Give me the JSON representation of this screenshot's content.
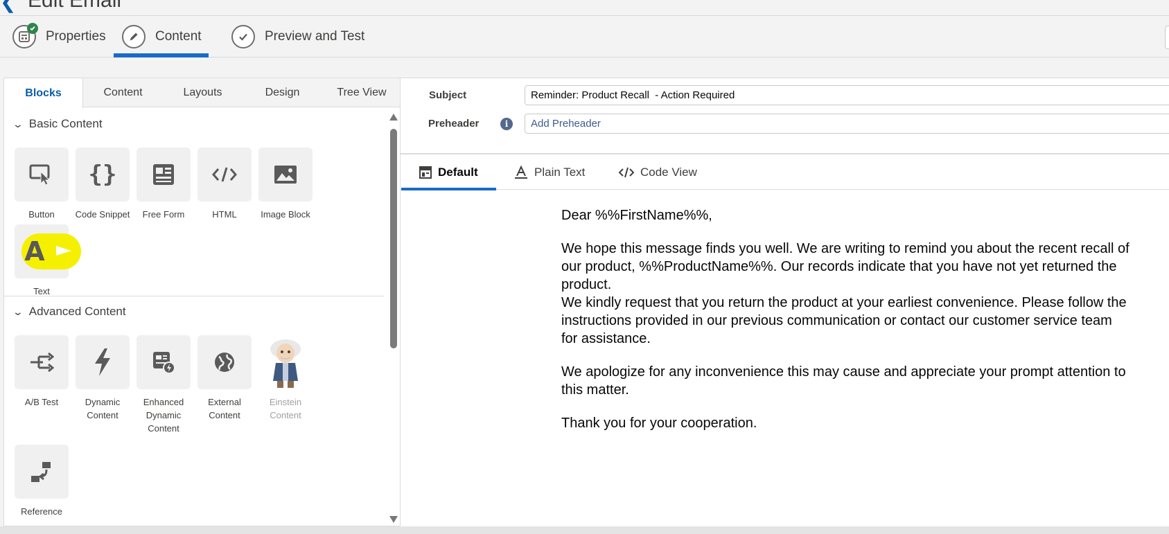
{
  "header": {
    "title": "Edit Email"
  },
  "steps": [
    {
      "label": "Properties",
      "icon": "properties-icon",
      "completed": true
    },
    {
      "label": "Content",
      "icon": "pencil-icon",
      "active": true
    },
    {
      "label": "Preview and Test",
      "icon": "checkmark-icon"
    }
  ],
  "left_tabs": [
    "Blocks",
    "Content",
    "Layouts",
    "Design",
    "Tree View"
  ],
  "basic_content": {
    "title": "Basic Content",
    "blocks": [
      {
        "label": "Button",
        "icon": "button-cursor-icon"
      },
      {
        "label": "Code Snippet",
        "icon": "curly-braces-icon"
      },
      {
        "label": "Free Form",
        "icon": "free-form-icon"
      },
      {
        "label": "HTML",
        "icon": "code-icon"
      },
      {
        "label": "Image Block",
        "icon": "image-icon"
      },
      {
        "label": "Text",
        "icon": "text-icon"
      }
    ]
  },
  "advanced_content": {
    "title": "Advanced Content",
    "blocks": [
      {
        "label": "A/B Test",
        "icon": "ab-test-icon"
      },
      {
        "label": "Dynamic Content",
        "icon": "lightning-icon"
      },
      {
        "label": "Enhanced Dynamic Content",
        "icon": "enhanced-dynamic-icon"
      },
      {
        "label": "External Content",
        "icon": "globe-icon"
      },
      {
        "label": "Einstein Content",
        "icon": "einstein-icon",
        "disabled": true
      },
      {
        "label": "Reference",
        "icon": "reference-icon"
      }
    ]
  },
  "fields": {
    "subject_label": "Subject",
    "subject_value": "Reminder: Product Recall  - Action Required",
    "preheader_label": "Preheader",
    "preheader_placeholder": "Add Preheader"
  },
  "view_tabs": [
    {
      "label": "Default",
      "icon": "layout-icon",
      "active": true
    },
    {
      "label": "Plain Text",
      "icon": "text-format-icon"
    },
    {
      "label": "Code View",
      "icon": "code-icon"
    }
  ],
  "email": {
    "greeting": "Dear %%FirstName%%,",
    "para1": "We hope this message finds you well. We are writing to remind you about the recent recall of our product, %%ProductName%%. Our records indicate that you have not yet returned the product.",
    "para2": "We kindly request that you return the product at your earliest convenience. Please follow the instructions provided in our previous communication or contact our customer service team for assistance.",
    "para3": "We apologize for any inconvenience this may cause and appreciate your prompt attention to this matter.",
    "closing": "Thank you for your cooperation."
  },
  "colors": {
    "accent": "#1b6ac9",
    "highlight": "#f5f000",
    "complete": "#2e844a"
  }
}
